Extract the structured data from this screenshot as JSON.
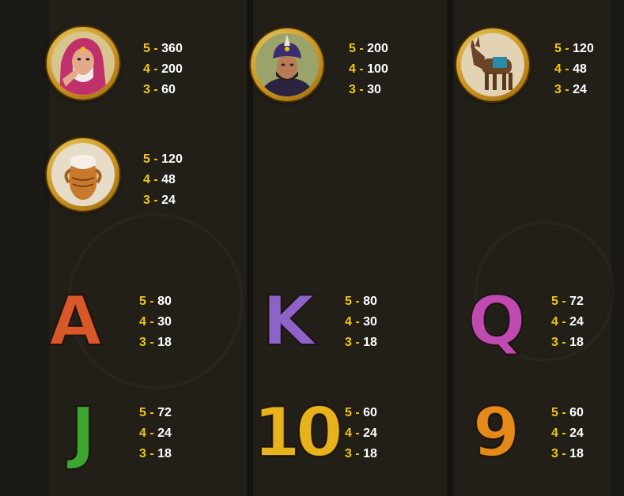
{
  "symbols": [
    {
      "id": "woman",
      "kind": "portrait",
      "icon": "veiled-woman-icon",
      "pays": [
        {
          "count": "5",
          "value": "360"
        },
        {
          "count": "4",
          "value": "200"
        },
        {
          "count": "3",
          "value": "60"
        }
      ]
    },
    {
      "id": "sultan",
      "kind": "portrait",
      "icon": "turbaned-man-icon",
      "pays": [
        {
          "count": "5",
          "value": "200"
        },
        {
          "count": "4",
          "value": "100"
        },
        {
          "count": "3",
          "value": "30"
        }
      ]
    },
    {
      "id": "donkey",
      "kind": "portrait",
      "icon": "donkey-icon",
      "pays": [
        {
          "count": "5",
          "value": "120"
        },
        {
          "count": "4",
          "value": "48"
        },
        {
          "count": "3",
          "value": "24"
        }
      ]
    },
    {
      "id": "jar",
      "kind": "portrait",
      "icon": "clay-jar-icon",
      "pays": [
        {
          "count": "5",
          "value": "120"
        },
        {
          "count": "4",
          "value": "48"
        },
        {
          "count": "3",
          "value": "24"
        }
      ]
    },
    {
      "id": "A",
      "kind": "letter",
      "label": "A",
      "color": "#d9582a",
      "pays": [
        {
          "count": "5",
          "value": "80"
        },
        {
          "count": "4",
          "value": "30"
        },
        {
          "count": "3",
          "value": "18"
        }
      ]
    },
    {
      "id": "K",
      "kind": "letter",
      "label": "K",
      "color": "#8e63c7",
      "pays": [
        {
          "count": "5",
          "value": "80"
        },
        {
          "count": "4",
          "value": "30"
        },
        {
          "count": "3",
          "value": "18"
        }
      ]
    },
    {
      "id": "Q",
      "kind": "letter",
      "label": "Q",
      "color": "#c04bb0",
      "pays": [
        {
          "count": "5",
          "value": "72"
        },
        {
          "count": "4",
          "value": "24"
        },
        {
          "count": "3",
          "value": "18"
        }
      ]
    },
    {
      "id": "J",
      "kind": "letter",
      "label": "J",
      "color": "#3da631",
      "pays": [
        {
          "count": "5",
          "value": "72"
        },
        {
          "count": "4",
          "value": "24"
        },
        {
          "count": "3",
          "value": "18"
        }
      ]
    },
    {
      "id": "10",
      "kind": "letter",
      "label": "10",
      "color": "#e8b21d",
      "pays": [
        {
          "count": "5",
          "value": "60"
        },
        {
          "count": "4",
          "value": "24"
        },
        {
          "count": "3",
          "value": "18"
        }
      ]
    },
    {
      "id": "9",
      "kind": "letter",
      "label": "9",
      "color": "#e48a1a",
      "pays": [
        {
          "count": "5",
          "value": "60"
        },
        {
          "count": "4",
          "value": "24"
        },
        {
          "count": "3",
          "value": "18"
        }
      ]
    }
  ],
  "separator": "-"
}
